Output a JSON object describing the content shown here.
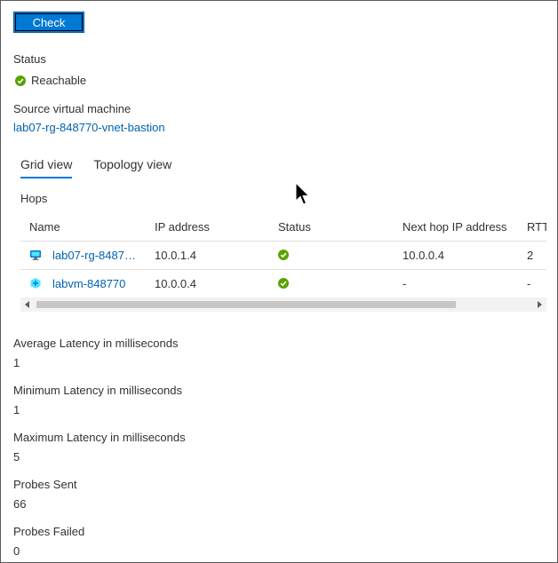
{
  "check_button": "Check",
  "status": {
    "label": "Status",
    "value": "Reachable"
  },
  "source_vm": {
    "label": "Source virtual machine",
    "value": "lab07-rg-848770-vnet-bastion"
  },
  "tabs": [
    {
      "label": "Grid view",
      "active": true
    },
    {
      "label": "Topology view",
      "active": false
    }
  ],
  "hops": {
    "title": "Hops",
    "columns": [
      "Name",
      "IP address",
      "Status",
      "Next hop IP address",
      "RTT"
    ],
    "rows": [
      {
        "icon": "virtual-machine-icon",
        "name": "lab07-rg-84877…",
        "ip": "10.0.1.4",
        "status": "success",
        "next_hop": "10.0.0.4",
        "rtt": "2"
      },
      {
        "icon": "network-interface-icon",
        "name": "labvm-848770",
        "ip": "10.0.0.4",
        "status": "success",
        "next_hop": "-",
        "rtt": "-"
      }
    ]
  },
  "metrics": [
    {
      "label": "Average Latency in milliseconds",
      "value": "1"
    },
    {
      "label": "Minimum Latency in milliseconds",
      "value": "1"
    },
    {
      "label": "Maximum Latency in milliseconds",
      "value": "5"
    },
    {
      "label": "Probes Sent",
      "value": "66"
    },
    {
      "label": "Probes Failed",
      "value": "0"
    }
  ],
  "colors": {
    "accent": "#0078d4",
    "link": "#0063b1",
    "success": "#57a300"
  }
}
